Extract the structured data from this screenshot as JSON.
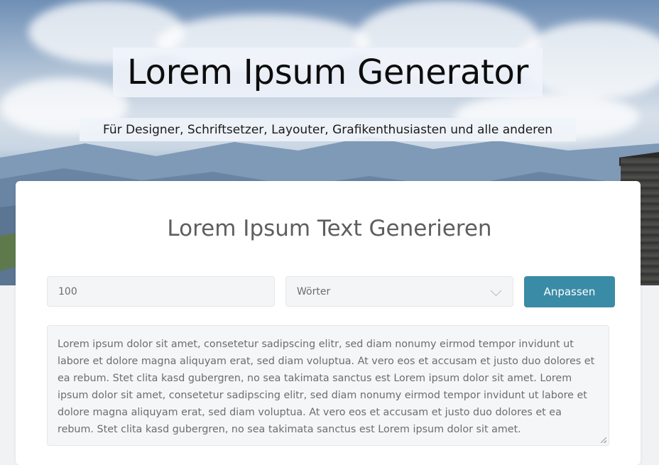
{
  "header": {
    "title": "Lorem Ipsum Generator",
    "subtitle": "Für Designer, Schriftsetzer, Layouter, Grafikenthusiasten und alle anderen"
  },
  "generator": {
    "heading": "Lorem Ipsum Text Generieren",
    "count_value": "100",
    "unit_selected": "Wörter",
    "submit_label": "Anpassen",
    "output_text": "Lorem ipsum dolor sit amet, consetetur sadipscing elitr, sed diam nonumy eirmod tempor invidunt ut labore et dolore magna aliquyam erat, sed diam voluptua. At vero eos et accusam et justo duo dolores et ea rebum. Stet clita kasd gubergren, no sea takimata sanctus est Lorem ipsum dolor sit amet. Lorem ipsum dolor sit amet, consetetur sadipscing elitr, sed diam nonumy eirmod tempor invidunt ut labore et dolore magna aliquyam erat, sed diam voluptua. At vero eos et accusam et justo duo dolores et ea rebum. Stet clita kasd gubergren, no sea takimata sanctus est Lorem ipsum dolor sit amet."
  },
  "colors": {
    "button": "#3a8ba6",
    "heading": "#5d5e5f",
    "field_bg": "#f4f5f6"
  },
  "icons": {
    "dropdown": "chevron-down-icon",
    "resize": "resize-handle-icon"
  }
}
